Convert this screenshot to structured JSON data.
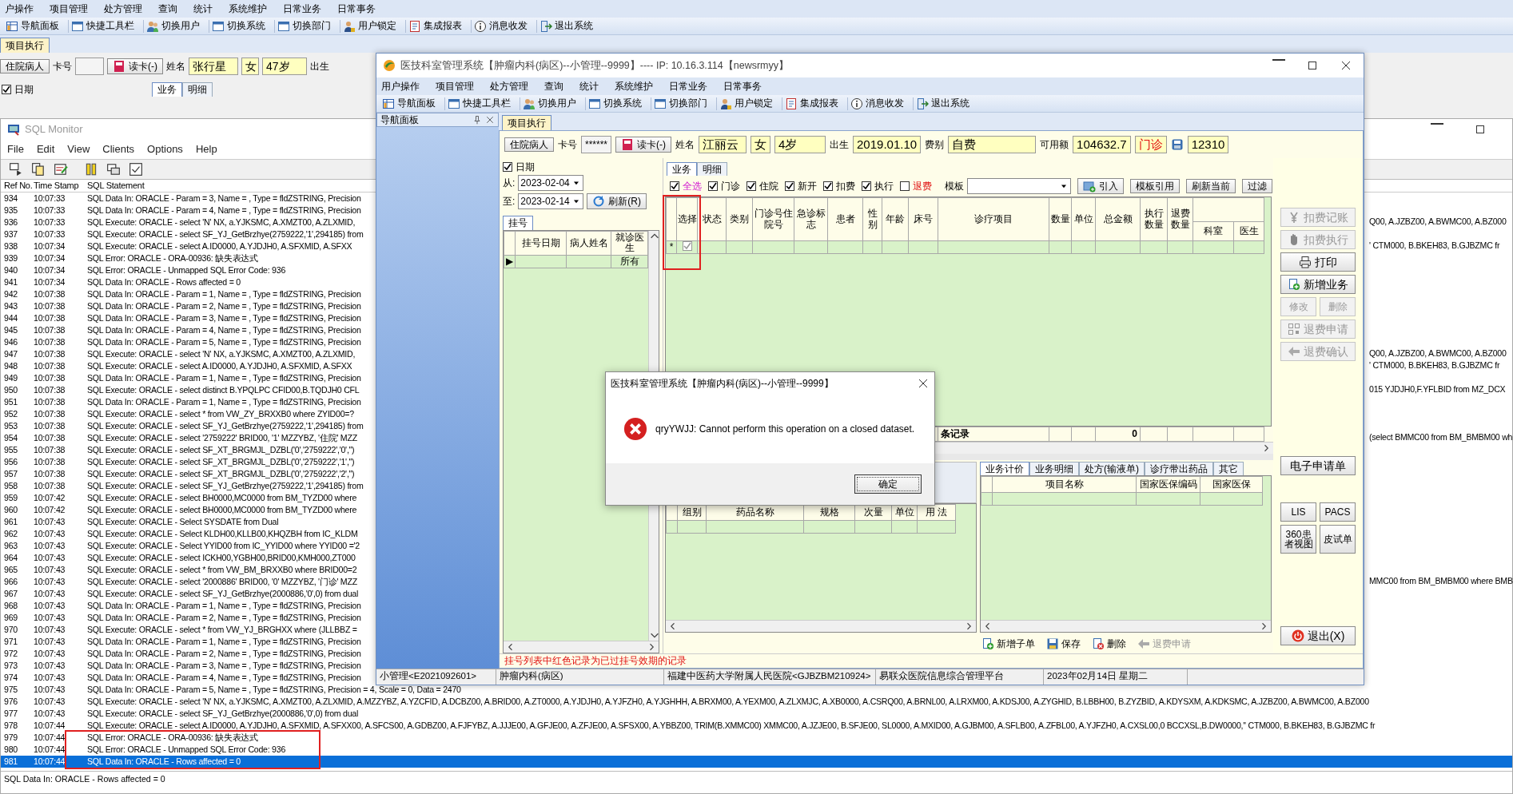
{
  "background_app": {
    "menu": [
      "户操作",
      "项目管理",
      "处方管理",
      "查询",
      "统计",
      "系统维护",
      "日常业务",
      "日常事务"
    ],
    "toolbar": [
      "导航面板",
      "快捷工具栏",
      "切换用户",
      "切换系统",
      "切换部门",
      "用户锁定",
      "集成报表",
      "消息收发",
      "退出系统"
    ],
    "tab": {
      "label": "项目执行",
      "selected": true
    },
    "patient": {
      "type_button": "住院病人",
      "card_label": "卡号",
      "read_button": "读卡(-)",
      "name_label": "姓名",
      "name": "张行星",
      "sex": "女",
      "age": "47岁",
      "birth_label": "出生"
    },
    "date_filter": {
      "label": "日期",
      "checked": true
    },
    "tabs": [
      {
        "label": "业务",
        "selected": true
      },
      {
        "label": "明细",
        "selected": false
      }
    ]
  },
  "sql_monitor": {
    "title": "SQL Monitor",
    "menu": [
      "File",
      "Edit",
      "View",
      "Clients",
      "Options",
      "Help"
    ],
    "columns": [
      "Ref No.",
      "Time Stamp",
      "SQL Statement"
    ],
    "rows": [
      {
        "ref": "934",
        "time": "10:07:33",
        "statement": "SQL Data In: ORACLE - Param = 3, Name = , Type = fldZSTRING, Precision",
        "selected": false,
        "annotated": false
      },
      {
        "ref": "935",
        "time": "10:07:33",
        "statement": "SQL Data In: ORACLE - Param = 4, Name = , Type = fldZSTRING, Precision",
        "selected": false,
        "annotated": false
      },
      {
        "ref": "936",
        "time": "10:07:33",
        "statement": "SQL Execute: ORACLE - select 'N' NX, a.YJKSMC,  A.XMZT00, A.ZLXMID,",
        "tail": "Q00, A.JZBZ00, A.BWMC00, A.BZ000",
        "selected": false,
        "annotated": false
      },
      {
        "ref": "937",
        "time": "10:07:33",
        "statement": "SQL Execute: ORACLE - select SF_YJ_GetBrzhye(2759222,'1',294185) from",
        "selected": false,
        "annotated": false
      },
      {
        "ref": "938",
        "time": "10:07:34",
        "statement": "SQL Execute: ORACLE - select   A.ID0000, A.YJDJH0, A.SFXMID, A.SFXX",
        "tail": "' CTM000,   B.BKEH83, B.GJBZMC   fr",
        "selected": false,
        "annotated": false
      },
      {
        "ref": "939",
        "time": "10:07:34",
        "statement": "SQL Error: ORACLE - ORA-00936: 缺失表达式",
        "selected": false,
        "annotated": false
      },
      {
        "ref": "940",
        "time": "10:07:34",
        "statement": "SQL Error: ORACLE - Unmapped SQL Error Code: 936",
        "selected": false,
        "annotated": false
      },
      {
        "ref": "941",
        "time": "10:07:34",
        "statement": "SQL Data In: ORACLE - Rows affected = 0",
        "selected": false,
        "annotated": false
      },
      {
        "ref": "942",
        "time": "10:07:38",
        "statement": "SQL Data In: ORACLE - Param = 1, Name = , Type = fldZSTRING, Precision",
        "selected": false,
        "annotated": false
      },
      {
        "ref": "943",
        "time": "10:07:38",
        "statement": "SQL Data In: ORACLE - Param = 2, Name = , Type = fldZSTRING, Precision",
        "selected": false,
        "annotated": false
      },
      {
        "ref": "944",
        "time": "10:07:38",
        "statement": "SQL Data In: ORACLE - Param = 3, Name = , Type = fldZSTRING, Precision",
        "selected": false,
        "annotated": false
      },
      {
        "ref": "945",
        "time": "10:07:38",
        "statement": "SQL Data In: ORACLE - Param = 4, Name = , Type = fldZSTRING, Precision",
        "selected": false,
        "annotated": false
      },
      {
        "ref": "946",
        "time": "10:07:38",
        "statement": "SQL Data In: ORACLE - Param = 5, Name = , Type = fldZSTRING, Precision",
        "selected": false,
        "annotated": false
      },
      {
        "ref": "947",
        "time": "10:07:38",
        "statement": "SQL Execute: ORACLE - select 'N' NX, a.YJKSMC,  A.XMZT00, A.ZLXMID,",
        "tail": "Q00, A.JZBZ00, A.BWMC00, A.BZ000",
        "selected": false,
        "annotated": false
      },
      {
        "ref": "948",
        "time": "10:07:38",
        "statement": "SQL Execute: ORACLE - select   A.ID0000, A.YJDJH0, A.SFXMID, A.SFXX",
        "tail": "' CTM000,   B.BKEH83, B.GJBZMC   fr",
        "selected": false,
        "annotated": false
      },
      {
        "ref": "949",
        "time": "10:07:38",
        "statement": "SQL Data In: ORACLE - Param = 1, Name = , Type = fldZSTRING, Precision",
        "selected": false,
        "annotated": false
      },
      {
        "ref": "950",
        "time": "10:07:38",
        "statement": "SQL Execute: ORACLE -   select distinct B.YPQLPC CFID00,B.TQDJH0 CFL",
        "tail": "015 YJDJH0,F.YFLBID   from MZ_DCX",
        "selected": false,
        "annotated": false
      },
      {
        "ref": "951",
        "time": "10:07:38",
        "statement": "SQL Data In: ORACLE - Param = 1, Name = , Type = fldZSTRING, Precision",
        "selected": false,
        "annotated": false
      },
      {
        "ref": "952",
        "time": "10:07:38",
        "statement": "SQL Execute: ORACLE - select * from VW_ZY_BRXXB0 where ZYID00=?",
        "selected": false,
        "annotated": false
      },
      {
        "ref": "953",
        "time": "10:07:38",
        "statement": "SQL Execute: ORACLE - select SF_YJ_GetBrzhye(2759222,'1',294185) from",
        "selected": false,
        "annotated": false
      },
      {
        "ref": "954",
        "time": "10:07:38",
        "statement": "SQL Execute: ORACLE - select '2759222' BRID00, '1' MZZYBZ, '住院' MZZ",
        "tail": "(select BMMC00 from BM_BMBM00 wh",
        "selected": false,
        "annotated": false
      },
      {
        "ref": "955",
        "time": "10:07:38",
        "statement": "SQL Execute: ORACLE - select SF_XT_BRGMJL_DZBL('0','2759222','0','')",
        "selected": false,
        "annotated": false
      },
      {
        "ref": "956",
        "time": "10:07:38",
        "statement": "SQL Execute: ORACLE - select SF_XT_BRGMJL_DZBL('0','2759222','1','')",
        "selected": false,
        "annotated": false
      },
      {
        "ref": "957",
        "time": "10:07:38",
        "statement": "SQL Execute: ORACLE - select SF_XT_BRGMJL_DZBL('0','2759222','2','')",
        "selected": false,
        "annotated": false
      },
      {
        "ref": "958",
        "time": "10:07:38",
        "statement": "SQL Execute: ORACLE - select SF_YJ_GetBrzhye(2759222,'1',294185) from",
        "selected": false,
        "annotated": false
      },
      {
        "ref": "959",
        "time": "10:07:42",
        "statement": "SQL Execute: ORACLE - select BH0000,MC0000 from BM_TYZD00 where",
        "selected": false,
        "annotated": false
      },
      {
        "ref": "960",
        "time": "10:07:42",
        "statement": "SQL Execute: ORACLE - select BH0000,MC0000 from BM_TYZD00 where",
        "selected": false,
        "annotated": false
      },
      {
        "ref": "961",
        "time": "10:07:43",
        "statement": "SQL Execute: ORACLE - Select SYSDATE from Dual",
        "selected": false,
        "annotated": false
      },
      {
        "ref": "962",
        "time": "10:07:43",
        "statement": "SQL Execute: ORACLE - Select KLDH00,KLLB00,KHQZBH from IC_KLDM",
        "selected": false,
        "annotated": false
      },
      {
        "ref": "963",
        "time": "10:07:43",
        "statement": "SQL Execute: ORACLE - Select YYID00 from IC_YYID00 where YYID00 ='2",
        "selected": false,
        "annotated": false
      },
      {
        "ref": "964",
        "time": "10:07:43",
        "statement": "SQL Execute: ORACLE - select ICKH00,YGBH00,BRID00,KMH000,ZT000",
        "selected": false,
        "annotated": false
      },
      {
        "ref": "965",
        "time": "10:07:43",
        "statement": "SQL Execute: ORACLE - select * from VW_BM_BRXXB0 where BRID00=2",
        "selected": false,
        "annotated": false
      },
      {
        "ref": "966",
        "time": "10:07:43",
        "statement": "SQL Execute: ORACLE - select '2000886' BRID00, '0' MZZYBZ, '门诊' MZZ",
        "tail": "MMC00 from BM_BMBM00 where BMB",
        "selected": false,
        "annotated": false
      },
      {
        "ref": "967",
        "time": "10:07:43",
        "statement": "SQL Execute: ORACLE - select SF_YJ_GetBrzhye(2000886,'0',0) from dual",
        "selected": false,
        "annotated": false
      },
      {
        "ref": "968",
        "time": "10:07:43",
        "statement": "SQL Data In: ORACLE - Param = 1, Name = , Type = fldZSTRING, Precision",
        "selected": false,
        "annotated": false
      },
      {
        "ref": "969",
        "time": "10:07:43",
        "statement": "SQL Data In: ORACLE - Param = 2, Name = , Type = fldZSTRING, Precision",
        "selected": false,
        "annotated": false
      },
      {
        "ref": "970",
        "time": "10:07:43",
        "statement": "SQL Execute: ORACLE - select * from VW_YJ_BRGHXX where (JLLBBZ =",
        "selected": false,
        "annotated": false
      },
      {
        "ref": "971",
        "time": "10:07:43",
        "statement": "SQL Data In: ORACLE - Param = 1, Name = , Type = fldZSTRING, Precision",
        "selected": false,
        "annotated": false
      },
      {
        "ref": "972",
        "time": "10:07:43",
        "statement": "SQL Data In: ORACLE - Param = 2, Name = , Type = fldZSTRING, Precision",
        "selected": false,
        "annotated": false
      },
      {
        "ref": "973",
        "time": "10:07:43",
        "statement": "SQL Data In: ORACLE - Param = 3, Name = , Type = fldZSTRING, Precision",
        "selected": false,
        "annotated": false
      },
      {
        "ref": "974",
        "time": "10:07:43",
        "statement": "SQL Data In: ORACLE - Param = 4, Name = , Type = fldZSTRING, Precision",
        "selected": false,
        "annotated": false
      },
      {
        "ref": "975",
        "time": "10:07:43",
        "statement": "SQL Data In: ORACLE - Param = 5, Name = , Type = fldZSTRING, Precision = 4, Scale = 0, Data = 2470",
        "selected": false,
        "annotated": false
      },
      {
        "ref": "976",
        "time": "10:07:43",
        "statement": "SQL Execute: ORACLE - select 'N' NX, a.YJKSMC,  A.XMZT00, A.ZLXMID, A.MZZYBZ, A.YZCFID, A.DCBZ00, A.BRID00, A.ZT0000, A.YJDJH0, A.YJFZH0, A.YJGHHH, A.BRXM00, A.YEXM00, A.ZLXMJC, A.XB0000, A.CSRQ00, A.BRNL00, A.LRXM00, A.KDSJ00, A.ZYGHID, B.LBBH00, B.ZYZBID, A.KDYSXM, A.KDKSMC, A.JZBZ00, A.BWMC00, A.BZ000",
        "selected": false,
        "annotated": false
      },
      {
        "ref": "977",
        "time": "10:07:43",
        "statement": "SQL Execute: ORACLE - select SF_YJ_GetBrzhye(2000886,'0',0) from dual",
        "selected": false,
        "annotated": false
      },
      {
        "ref": "978",
        "time": "10:07:44",
        "statement": "SQL Execute: ORACLE - select   A.ID0000, A.YJDJH0, A.SFXMID, A.SFXX00, A.SFCS00, A.GDBZ00, A.FJFYBZ, A.JJJE00, A.GFJE00, A.ZFJE00, A.SFSX00, A.YBBZ00, TRIM(B.XMMC00) XMMC00, A.JZJE00, B.SFJE00, SL0000, A.MXID00, A.GJBM00, A.SFLB00, A.ZFBL00, A.YJFZH0, A.CXSL00,0 BCCXSL,B.DW0000,'' CTM000,   B.BKEH83, B.GJBZMC   fr",
        "selected": false,
        "annotated": false
      },
      {
        "ref": "979",
        "time": "10:07:44",
        "statement": "SQL Error: ORACLE - ORA-00936: 缺失表达式",
        "selected": false,
        "annotated": true
      },
      {
        "ref": "980",
        "time": "10:07:44",
        "statement": "SQL Error: ORACLE - Unmapped SQL Error Code: 936",
        "selected": false,
        "annotated": true
      },
      {
        "ref": "981",
        "time": "10:07:44",
        "statement": "SQL Data In: ORACLE - Rows affected = 0",
        "selected": true,
        "annotated": true
      }
    ],
    "status": "SQL Data In: ORACLE - Rows affected = 0"
  },
  "main_window": {
    "title": "医技科室管理系统【肿瘤内科(病区)--小管理--9999】---- IP: 10.16.3.114【newsrmyy】",
    "menu": [
      "用户操作",
      "项目管理",
      "处方管理",
      "查询",
      "统计",
      "系统维护",
      "日常业务",
      "日常事务"
    ],
    "toolbar": [
      "导航面板",
      "快捷工具栏",
      "切换用户",
      "切换系统",
      "切换部门",
      "用户锁定",
      "集成报表",
      "消息收发",
      "退出系统"
    ],
    "nav_panel": {
      "title": "导航面板"
    },
    "tab": {
      "label": "项目执行",
      "selected": true
    },
    "patient": {
      "type_button": "住院病人",
      "card_label": "卡号",
      "card_value": "******",
      "read_button": "读卡(-)",
      "name_label": "姓名",
      "name": "江丽云",
      "sex": "女",
      "age": "4岁",
      "birth_label": "出生",
      "birth": "2019.01.10",
      "fee_label": "费别",
      "fee": "自费",
      "balance_label": "可用额",
      "balance": "104632.7",
      "visit_type": "门诊",
      "card_no": "12310"
    },
    "left_pane": {
      "date_filter": {
        "label": "日期",
        "checked": true
      },
      "from_label": "从:",
      "from": "2023-02-04",
      "to_label": "至:",
      "to": "2023-02-14",
      "refresh": "刷新(R)",
      "tab": {
        "label": "挂号",
        "selected": true
      },
      "columns": [
        "挂号日期",
        "病人姓名",
        "就诊医生"
      ],
      "rows": [
        {
          "marker": "▶",
          "doctor": "所有"
        }
      ]
    },
    "tabs": [
      {
        "label": "业务",
        "selected": true
      },
      {
        "label": "明细",
        "selected": false
      }
    ],
    "filters": [
      {
        "label": "全选",
        "checked": true,
        "kind": "select_all"
      },
      {
        "label": "门诊",
        "checked": true,
        "kind": "normal"
      },
      {
        "label": "住院",
        "checked": true,
        "kind": "normal"
      },
      {
        "label": "新开",
        "checked": true,
        "kind": "normal"
      },
      {
        "label": "扣费",
        "checked": true,
        "kind": "normal"
      },
      {
        "label": "执行",
        "checked": true,
        "kind": "normal"
      },
      {
        "label": "退费",
        "checked": false,
        "kind": "refund"
      }
    ],
    "template_label": "模板",
    "buttons": [
      "引入",
      "模板引用",
      "刷新当前",
      "过滤"
    ],
    "grid": {
      "columns": [
        {
          "label": "选择",
          "annotated": true
        },
        {
          "label": "状态",
          "annotated": false
        },
        {
          "label": "类别",
          "annotated": false
        },
        {
          "label": "门诊号住院号",
          "annotated": false
        },
        {
          "label": "急诊标志",
          "annotated": false
        },
        {
          "label": "患者",
          "annotated": false
        },
        {
          "label": "性别",
          "annotated": false
        },
        {
          "label": "年龄",
          "annotated": false
        },
        {
          "label": "床号",
          "annotated": false
        },
        {
          "label": "诊疗项目",
          "annotated": false
        },
        {
          "label": "数量",
          "annotated": false
        },
        {
          "label": "单位",
          "annotated": false
        },
        {
          "label": "总金额",
          "annotated": false
        },
        {
          "label": "执行数量",
          "annotated": false
        },
        {
          "label": "退费数量",
          "annotated": false
        }
      ],
      "group_columns": [
        "科室",
        "医生"
      ],
      "new_row": {
        "marker": "*",
        "checked": true
      },
      "footer": {
        "count_label": "条记录",
        "total": "0"
      }
    },
    "bottom_left_grid": {
      "columns": [
        "组别",
        "药品名称",
        "规格",
        "次量",
        "单位",
        "用 法"
      ]
    },
    "bottom_tabs": [
      {
        "label": "业务计价",
        "selected": true
      },
      {
        "label": "业务明细",
        "selected": false
      },
      {
        "label": "处方(输液单)",
        "selected": false
      },
      {
        "label": "诊疗带出药品",
        "selected": false
      },
      {
        "label": "其它",
        "selected": false
      }
    ],
    "bottom_right_grid": {
      "columns": [
        "项目名称",
        "国家医保编码",
        "国家医保"
      ]
    },
    "bottom_toolbar": [
      {
        "label": "新增子单",
        "disabled": false
      },
      {
        "label": "保存",
        "disabled": false
      },
      {
        "label": "删除",
        "disabled": false
      },
      {
        "label": "退费申请",
        "disabled": true
      }
    ],
    "side_buttons": [
      [
        {
          "label": "扣费记账",
          "disabled": true
        }
      ],
      [
        {
          "label": "扣费执行",
          "disabled": true
        }
      ],
      [
        {
          "label": "打印",
          "disabled": false
        }
      ],
      [
        {
          "label": "新增业务",
          "disabled": false
        }
      ],
      [
        {
          "label": "修改",
          "disabled": true
        },
        {
          "label": "删除",
          "disabled": true
        }
      ],
      [
        {
          "label": "退费申请",
          "disabled": true
        }
      ],
      [
        {
          "label": "退费确认",
          "disabled": true
        }
      ],
      [
        {
          "label": "电子申请单",
          "disabled": false
        }
      ],
      [
        {
          "label": "LIS",
          "disabled": false
        },
        {
          "label": "PACS",
          "disabled": false
        }
      ],
      [
        {
          "label": "360患者视图",
          "disabled": false
        },
        {
          "label": "皮试单",
          "disabled": false
        }
      ],
      [
        {
          "label": "退出(X)",
          "disabled": false
        }
      ]
    ],
    "notice": "挂号列表中红色记录为已过挂号效期的记录",
    "status_bar": [
      "小管理<E2021092601>",
      "肿瘤内科(病区)",
      "福建中医药大学附属人民医院<GJBZBM210924>",
      "易联众医院信息综合管理平台",
      "2023年02月14日 星期二"
    ]
  },
  "dialog": {
    "title": "医技科室管理系统【肿瘤内科(病区)--小管理--9999】",
    "message": "qryYWJJ: Cannot perform this operation on a closed dataset.",
    "button": "确定"
  }
}
